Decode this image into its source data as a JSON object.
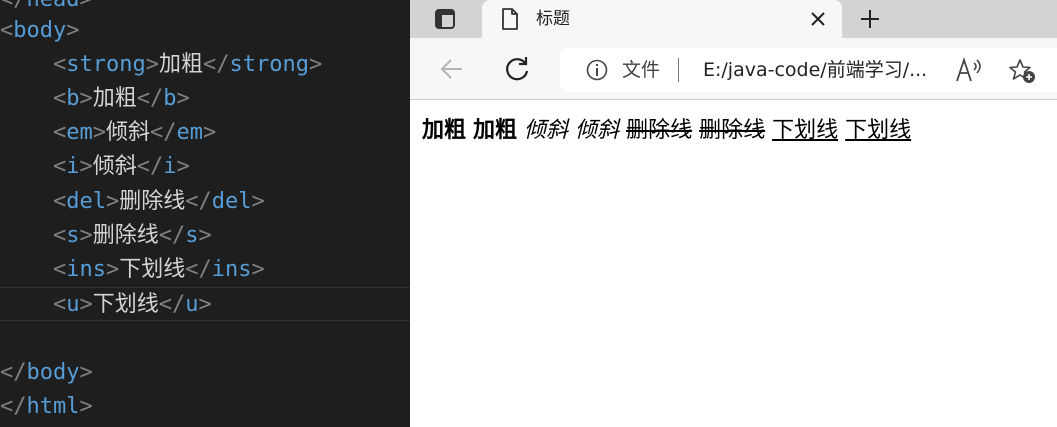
{
  "editor": {
    "lines": [
      {
        "indent": "",
        "close": true,
        "tag": "head",
        "text": ""
      },
      {
        "indent": "",
        "close": false,
        "tag": "body",
        "text": ""
      },
      {
        "indent": "    ",
        "tag": "strong",
        "text": "加粗"
      },
      {
        "indent": "    ",
        "tag": "b",
        "text": "加粗"
      },
      {
        "indent": "    ",
        "tag": "em",
        "text": "倾斜"
      },
      {
        "indent": "    ",
        "tag": "i",
        "text": "倾斜"
      },
      {
        "indent": "    ",
        "tag": "del",
        "text": "删除线"
      },
      {
        "indent": "    ",
        "tag": "s",
        "text": "删除线"
      },
      {
        "indent": "    ",
        "tag": "ins",
        "text": "下划线"
      },
      {
        "indent": "    ",
        "tag": "u",
        "text": "下划线"
      },
      {
        "indent": "",
        "tag": "",
        "text": ""
      },
      {
        "indent": "",
        "close": true,
        "tag": "body",
        "text": ""
      },
      {
        "indent": "",
        "close": true,
        "tag": "html",
        "text": ""
      }
    ]
  },
  "browser": {
    "tab": {
      "title": "标题",
      "close_glyph": "✕",
      "new_tab_glyph": "+"
    },
    "address": {
      "label": "文件",
      "url": "E:/java-code/前端学习/..."
    },
    "content": [
      {
        "tag": "strong",
        "text": "加粗"
      },
      {
        "tag": "b",
        "text": "加粗"
      },
      {
        "tag": "em",
        "text": "倾斜"
      },
      {
        "tag": "i",
        "text": "倾斜"
      },
      {
        "tag": "del",
        "text": "删除线"
      },
      {
        "tag": "s",
        "text": "删除线"
      },
      {
        "tag": "ins",
        "text": "下划线"
      },
      {
        "tag": "u",
        "text": "下划线"
      }
    ]
  }
}
